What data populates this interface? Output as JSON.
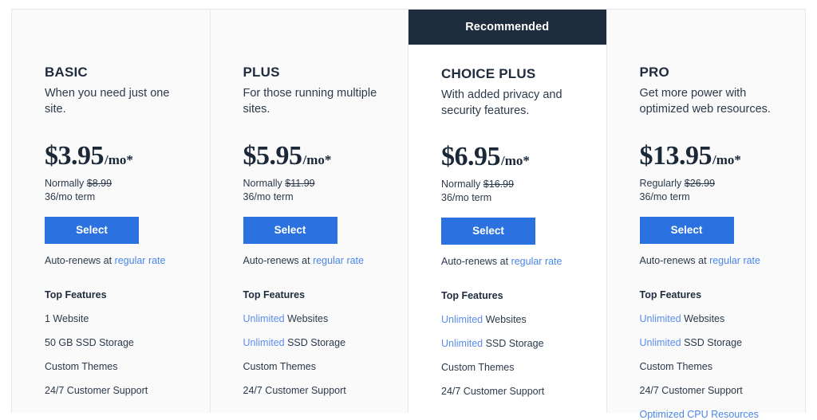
{
  "colors": {
    "accent_blue": "#2b72e0",
    "link_blue": "#4a86e8",
    "highlight_blue": "#5b8def",
    "dark_navy": "#1e2c3e",
    "card_bg": "#fafafa",
    "featured_card_bg": "#ffffff"
  },
  "plans": [
    {
      "name": "BASIC",
      "description": "When you need just one site.",
      "price": "$3.95",
      "period": "/mo*",
      "compare_label": "Normally",
      "compare_price": "$8.99",
      "term": "36/mo term",
      "select_label": "Select",
      "renew_prefix": "Auto-renews at",
      "renew_link": "regular rate",
      "features_title": "Top Features",
      "features": [
        {
          "highlight": "",
          "text": "1 Website"
        },
        {
          "highlight": "",
          "text": "50 GB SSD Storage"
        },
        {
          "highlight": "",
          "text": "Custom Themes"
        },
        {
          "highlight": "",
          "text": "24/7 Customer Support"
        }
      ],
      "recommended": false,
      "badge": ""
    },
    {
      "name": "PLUS",
      "description": "For those running multiple sites.",
      "price": "$5.95",
      "period": "/mo*",
      "compare_label": "Normally",
      "compare_price": "$11.99",
      "term": "36/mo term",
      "select_label": "Select",
      "renew_prefix": "Auto-renews at",
      "renew_link": "regular rate",
      "features_title": "Top Features",
      "features": [
        {
          "highlight": "Unlimited",
          "text": " Websites"
        },
        {
          "highlight": "Unlimited",
          "text": " SSD Storage"
        },
        {
          "highlight": "",
          "text": "Custom Themes"
        },
        {
          "highlight": "",
          "text": "24/7 Customer Support"
        }
      ],
      "recommended": false,
      "badge": ""
    },
    {
      "name": "CHOICE PLUS",
      "description": "With added privacy and security features.",
      "price": "$6.95",
      "period": "/mo*",
      "compare_label": "Normally",
      "compare_price": "$16.99",
      "term": "36/mo term",
      "select_label": "Select",
      "renew_prefix": "Auto-renews at",
      "renew_link": "regular rate",
      "features_title": "Top Features",
      "features": [
        {
          "highlight": "Unlimited",
          "text": " Websites"
        },
        {
          "highlight": "Unlimited",
          "text": " SSD Storage"
        },
        {
          "highlight": "",
          "text": "Custom Themes"
        },
        {
          "highlight": "",
          "text": "24/7 Customer Support"
        }
      ],
      "recommended": true,
      "badge": "Recommended"
    },
    {
      "name": "PRO",
      "description": "Get more power with optimized web resources.",
      "price": "$13.95",
      "period": "/mo*",
      "compare_label": "Regularly",
      "compare_price": "$26.99",
      "term": "36/mo term",
      "select_label": "Select",
      "renew_prefix": "Auto-renews at",
      "renew_link": "regular rate",
      "features_title": "Top Features",
      "features": [
        {
          "highlight": "Unlimited",
          "text": " Websites"
        },
        {
          "highlight": "Unlimited",
          "text": " SSD Storage"
        },
        {
          "highlight": "",
          "text": "Custom Themes"
        },
        {
          "highlight": "",
          "text": "24/7 Customer Support"
        },
        {
          "highlight": "",
          "text": "Optimized CPU Resources",
          "all_link": true
        }
      ],
      "recommended": false,
      "badge": ""
    }
  ]
}
